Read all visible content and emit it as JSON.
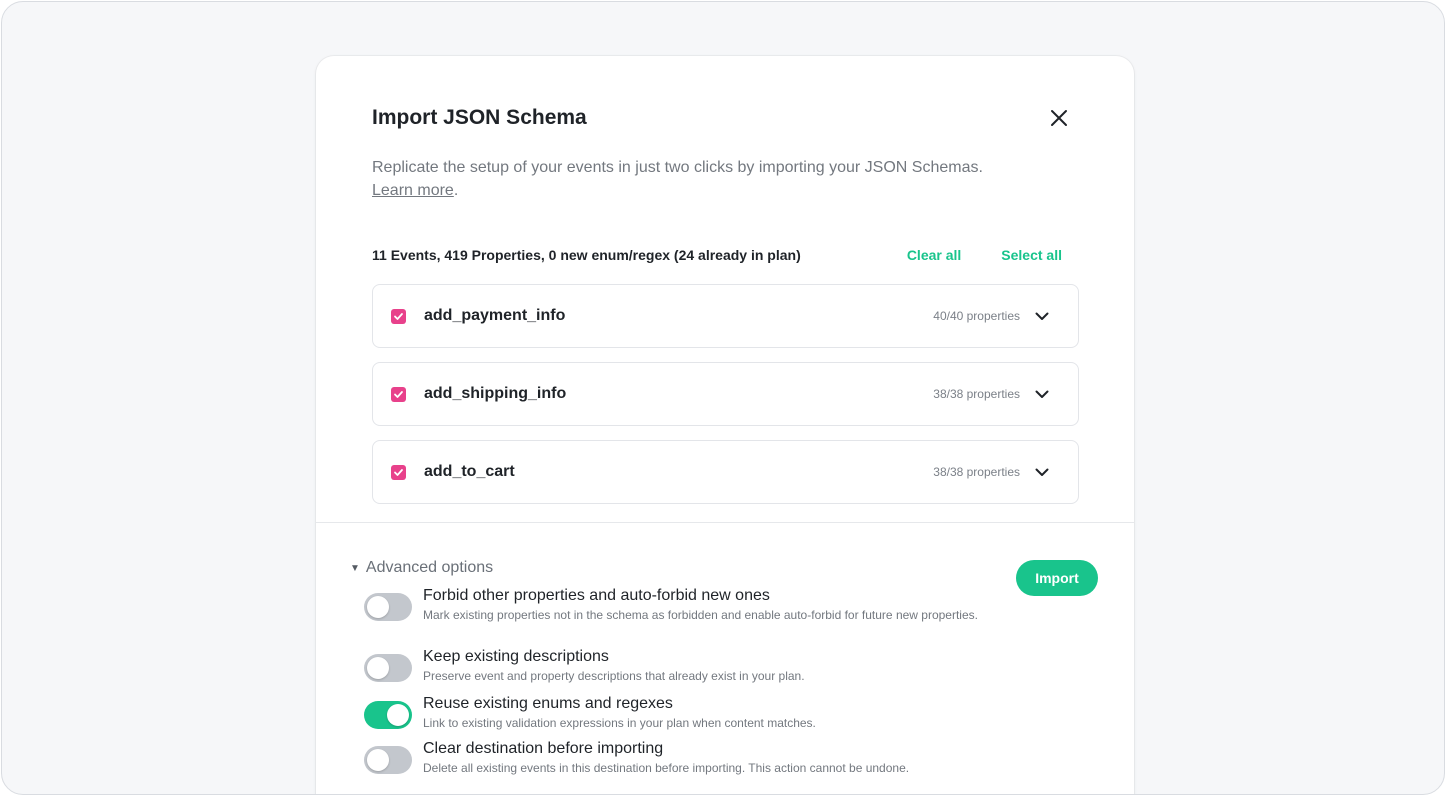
{
  "modal": {
    "title": "Import JSON Schema",
    "description": "Replicate the setup of your events in just two clicks by importing your JSON Schemas.",
    "learn_more": "Learn more",
    "learn_more_suffix": "."
  },
  "summary": {
    "text": "11 Events, 419 Properties, 0 new enum/regex (24 already in plan)",
    "clear_all": "Clear all",
    "select_all": "Select all"
  },
  "events": [
    {
      "name": "add_payment_info",
      "count": "40/40 properties",
      "checked": true
    },
    {
      "name": "add_shipping_info",
      "count": "38/38 properties",
      "checked": true
    },
    {
      "name": "add_to_cart",
      "count": "38/38 properties",
      "checked": true
    }
  ],
  "advanced": {
    "label": "Advanced options",
    "import_label": "Import",
    "options": [
      {
        "title": "Forbid other properties and auto-forbid new ones",
        "subtitle": "Mark existing properties not in the schema as forbidden and enable auto-forbid for future new properties.",
        "enabled": false
      },
      {
        "title": "Keep existing descriptions",
        "subtitle": "Preserve event and property descriptions that already exist in your plan.",
        "enabled": false
      },
      {
        "title": "Reuse existing enums and regexes",
        "subtitle": "Link to existing validation expressions in your plan when content matches.",
        "enabled": true
      },
      {
        "title": "Clear destination before importing",
        "subtitle": "Delete all existing events in this destination before importing. This action cannot be undone.",
        "enabled": false
      }
    ]
  },
  "colors": {
    "accent": "#19c48c",
    "checkbox": "#e8418b",
    "toggle_off": "#c3c7cd"
  },
  "icons": {
    "close": "close-icon",
    "check": "check-icon",
    "chevron": "chevron-down-icon",
    "triangle": "triangle-down-icon"
  }
}
